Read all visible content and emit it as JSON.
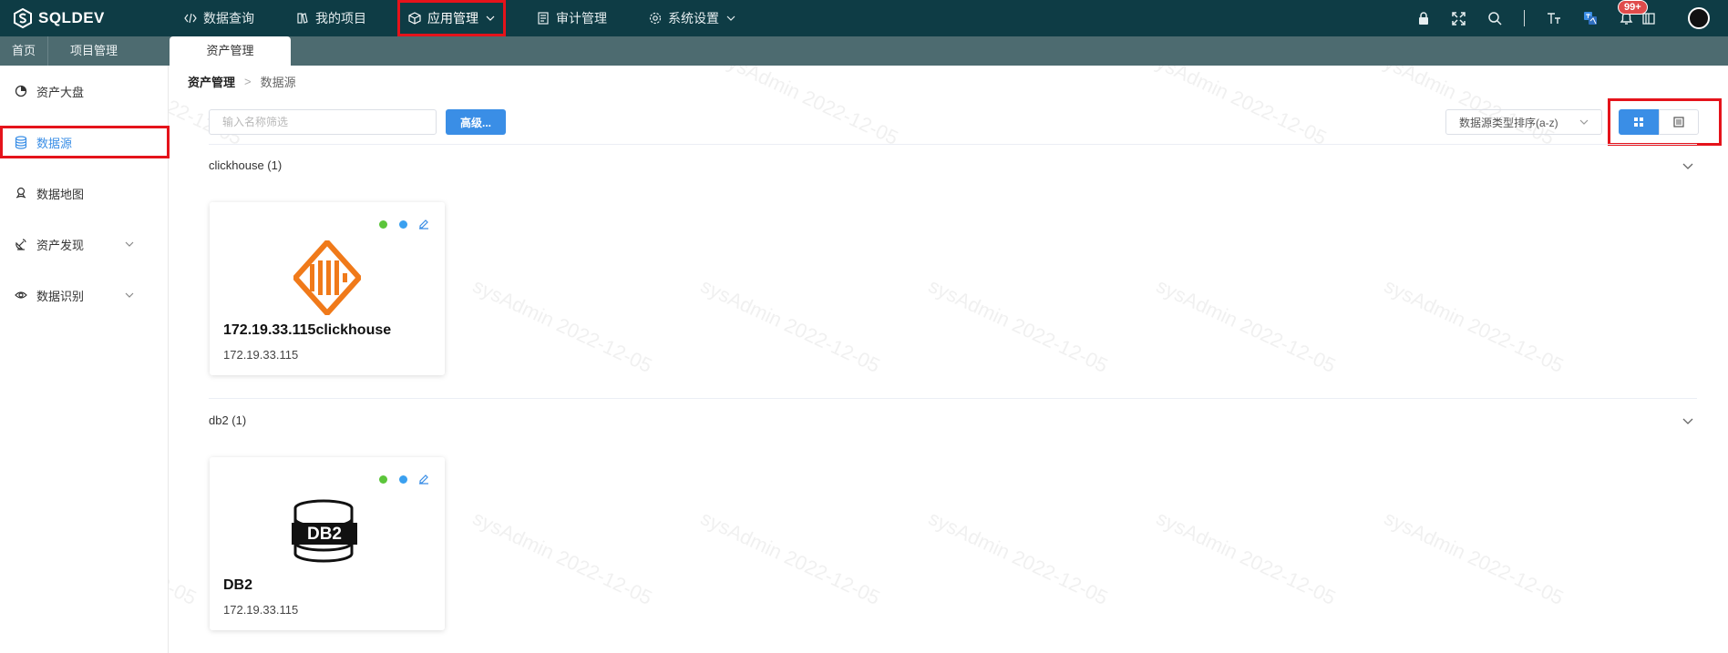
{
  "app": {
    "logo_text": "SQLDEV"
  },
  "topnav": [
    {
      "label": "数据查询",
      "icon": "code-icon"
    },
    {
      "label": "我的项目",
      "icon": "book-icon"
    },
    {
      "label": "应用管理",
      "icon": "box-icon",
      "active": true
    },
    {
      "label": "审计管理",
      "icon": "document-icon"
    },
    {
      "label": "系统设置",
      "icon": "gear-icon"
    }
  ],
  "notifications": {
    "badge": "99+"
  },
  "tabs": {
    "home": "首页",
    "project": "项目管理",
    "asset": "资产管理"
  },
  "sidebar": {
    "items": [
      {
        "label": "资产大盘",
        "icon": "pie-chart-icon"
      },
      {
        "label": "数据源",
        "icon": "database-icon",
        "active": true
      },
      {
        "label": "数据地图",
        "icon": "map-pin-icon"
      },
      {
        "label": "资产发现",
        "icon": "satellite-icon"
      },
      {
        "label": "数据识别",
        "icon": "eye-icon"
      }
    ]
  },
  "breadcrumb": {
    "root": "资产管理",
    "current": "数据源"
  },
  "filter": {
    "search_placeholder": "输入名称筛选",
    "advanced_label": "高级...",
    "sort_label": "数据源类型排序(a-z)"
  },
  "groups": [
    {
      "title": "clickhouse (1)",
      "cards": [
        {
          "name": "172.19.33.115clickhouse",
          "host": "172.19.33.115",
          "logo": "clickhouse-logo"
        }
      ]
    },
    {
      "title": "db2 (1)",
      "cards": [
        {
          "name": "DB2",
          "host": "172.19.33.115",
          "logo": "db2-logo",
          "logo_text": "DB2"
        }
      ]
    }
  ],
  "watermark": "sysAdmin 2022-12-05",
  "colors": {
    "topbar": "#0e3c45",
    "accent": "#3a8ee6",
    "highlight": "#e5131b",
    "clickhouse": "#f07a1a"
  }
}
